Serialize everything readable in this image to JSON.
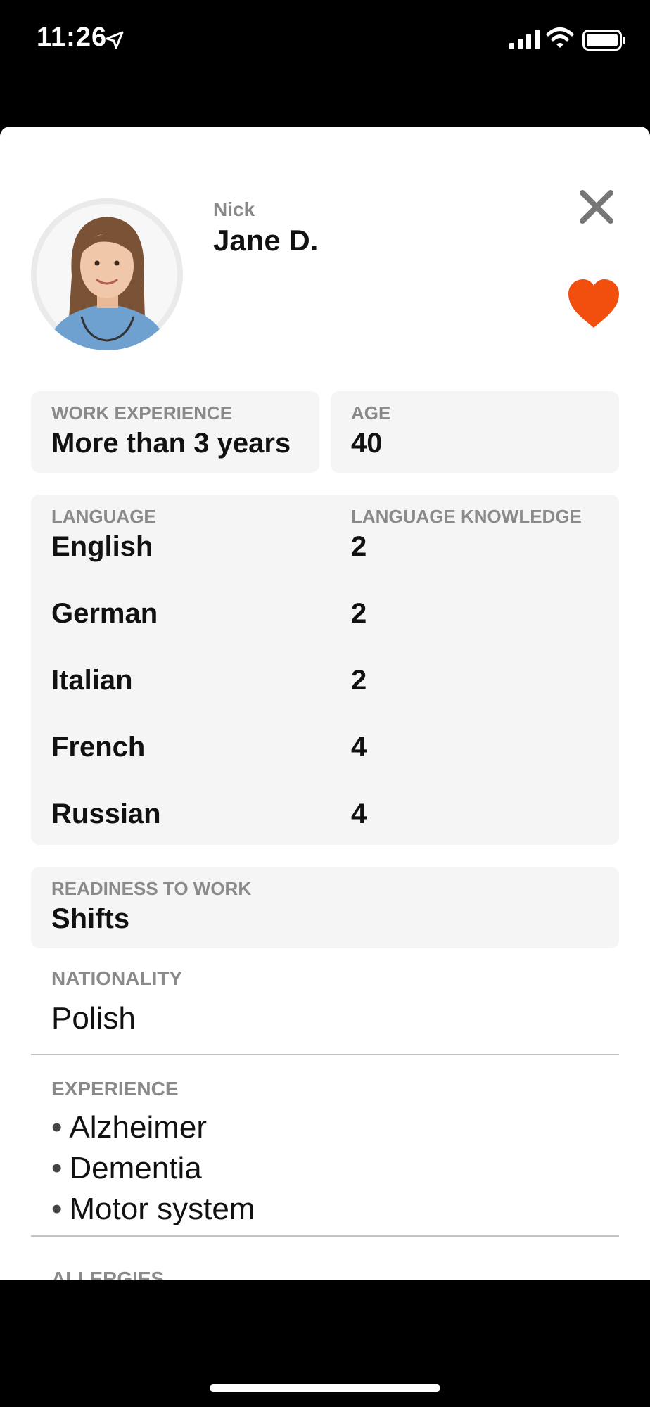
{
  "status_bar": {
    "time": "11:26"
  },
  "profile": {
    "nick_label": "Nick",
    "name": "Jane D.",
    "favorite_color": "#F24E0E"
  },
  "work_experience": {
    "label": "WORK EXPERIENCE",
    "value": "More than 3 years"
  },
  "age": {
    "label": "AGE",
    "value": "40"
  },
  "languages": {
    "header_language": "LANGUAGE",
    "header_knowledge": "LANGUAGE KNOWLEDGE",
    "items": [
      {
        "name": "English",
        "level": "2"
      },
      {
        "name": "German",
        "level": "2"
      },
      {
        "name": "Italian",
        "level": "2"
      },
      {
        "name": "French",
        "level": "4"
      },
      {
        "name": "Russian",
        "level": "4"
      }
    ]
  },
  "readiness": {
    "label": "READINESS TO WORK",
    "value": "Shifts"
  },
  "nationality": {
    "label": "NATIONALITY",
    "value": "Polish"
  },
  "experience": {
    "label": "EXPERIENCE",
    "items": [
      "Alzheimer",
      "Dementia",
      "Motor system"
    ]
  },
  "allergies": {
    "label": "ALLERGIES"
  }
}
